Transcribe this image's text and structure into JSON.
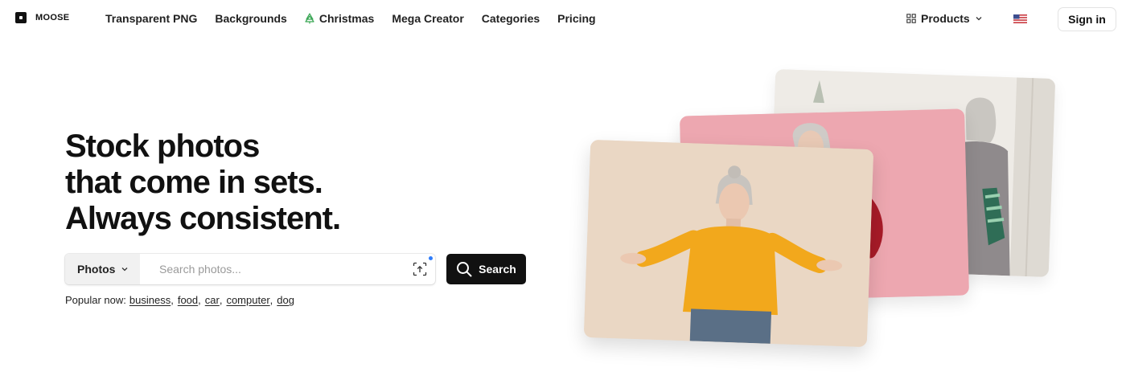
{
  "header": {
    "logo_text": "MOOSE",
    "nav": [
      "Transparent PNG",
      "Backgrounds",
      "Christmas",
      "Mega Creator",
      "Categories",
      "Pricing"
    ],
    "products_label": "Products",
    "signin_label": "Sign in"
  },
  "hero": {
    "headline": [
      "Stock photos",
      "that come in sets.",
      "Always consistent."
    ]
  },
  "search": {
    "filter_label": "Photos",
    "placeholder": "Search photos...",
    "button_label": "Search"
  },
  "popular": {
    "label": "Popular now:",
    "terms": [
      "business",
      "food",
      "car",
      "computer",
      "dog"
    ]
  },
  "colors": {
    "brand_dark": "#111111",
    "accent_dot": "#2f7dfa",
    "christmas_icon": "#3aa655",
    "card_pink": "#eda7b0",
    "card_beige": "#ead7c4"
  },
  "icons": [
    "logo-mark-icon",
    "christmas-tree-icon",
    "products-grid-icon",
    "chevron-down-icon",
    "us-flag-icon",
    "visual-search-icon",
    "search-icon"
  ]
}
